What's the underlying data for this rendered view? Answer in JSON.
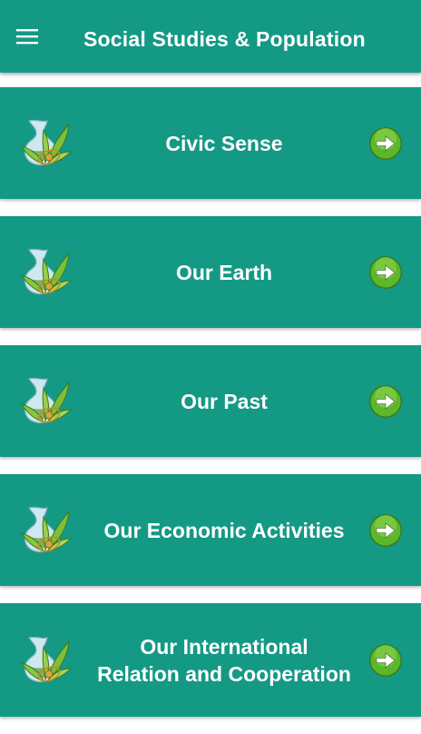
{
  "app_bar": {
    "title": "Social Studies & Population",
    "menu_icon": "hamburger-menu-icon"
  },
  "colors": {
    "primary": "#149985",
    "text": "#ffffff",
    "arrow_green": "#5cb82a"
  },
  "items": [
    {
      "label_lines": [
        "Civic Sense"
      ],
      "icon": "plant-globe-icon",
      "action_icon": "arrow-right-icon"
    },
    {
      "label_lines": [
        "Our Earth"
      ],
      "icon": "plant-globe-icon",
      "action_icon": "arrow-right-icon"
    },
    {
      "label_lines": [
        "Our Past"
      ],
      "icon": "plant-globe-icon",
      "action_icon": "arrow-right-icon"
    },
    {
      "label_lines": [
        "Our Economic Activities"
      ],
      "icon": "plant-globe-icon",
      "action_icon": "arrow-right-icon"
    },
    {
      "label_lines": [
        "Our International",
        "Relation and Cooperation"
      ],
      "icon": "plant-globe-icon",
      "action_icon": "arrow-right-icon"
    }
  ]
}
